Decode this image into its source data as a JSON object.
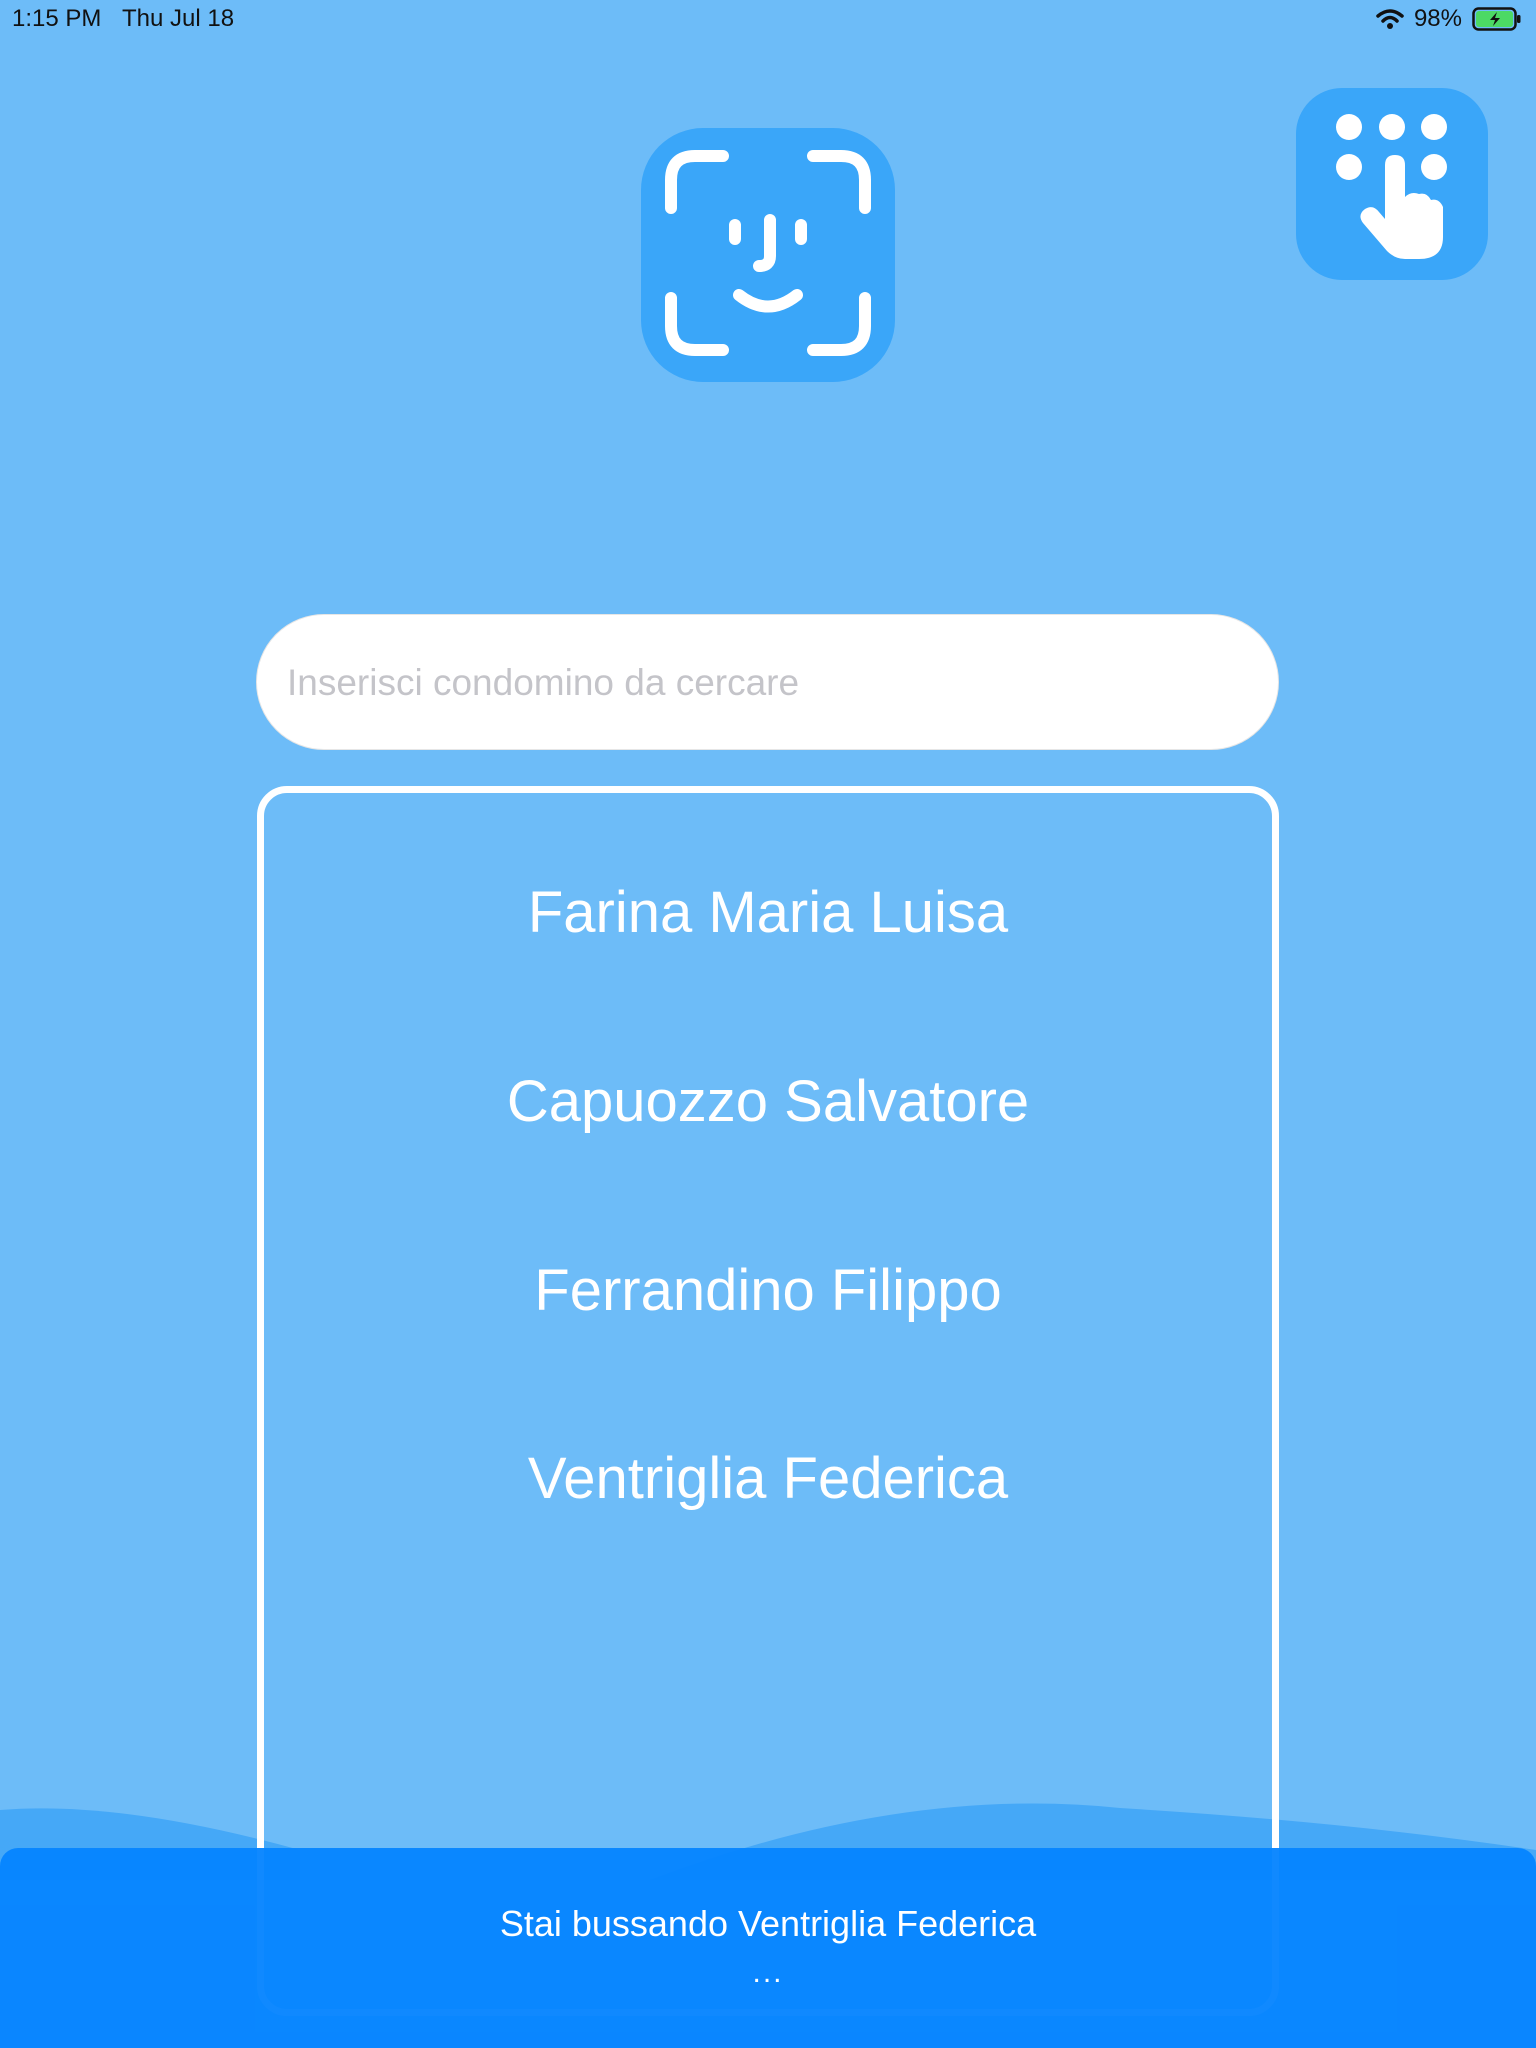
{
  "status_bar": {
    "time": "1:15 PM",
    "date": "Thu Jul 18",
    "battery_percent": "98%",
    "battery_level": 0.98,
    "icons": [
      "wifi-icon",
      "battery-charging-icon"
    ]
  },
  "buttons": {
    "face_id_icon": "face-id-icon",
    "keypad_icon": "keypad-touch-icon"
  },
  "search": {
    "placeholder": "Inserisci condomino da cercare",
    "value": ""
  },
  "residents": [
    {
      "name": "Farina Maria Luisa"
    },
    {
      "name": "Capuozzo Salvatore"
    },
    {
      "name": "Ferrandino Filippo"
    },
    {
      "name": "Ventriglia Federica"
    }
  ],
  "toast": {
    "message": "Stai bussando Ventriglia Federica",
    "ellipsis": "..."
  },
  "colors": {
    "background": "#6dbcf8",
    "button": "#3aa6f9",
    "toast": "#0684ff",
    "battery_fill": "#4cd964"
  }
}
